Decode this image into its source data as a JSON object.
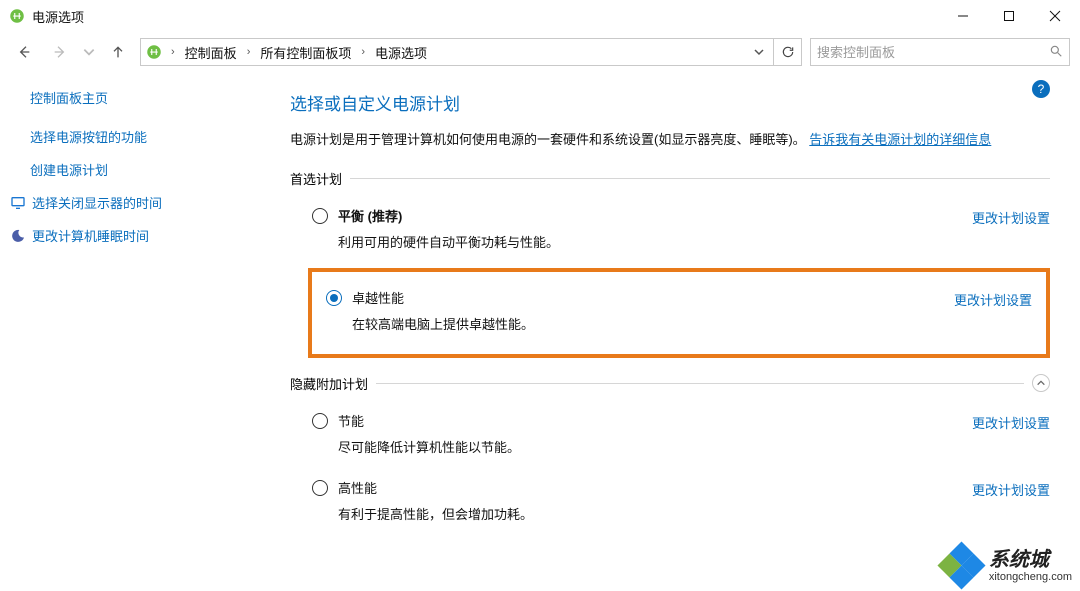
{
  "window": {
    "title": "电源选项"
  },
  "breadcrumb": {
    "seg1": "控制面板",
    "seg2": "所有控制面板项",
    "seg3": "电源选项"
  },
  "search": {
    "placeholder": "搜索控制面板"
  },
  "sidebar": {
    "home": "控制面板主页",
    "links": [
      "选择电源按钮的功能",
      "创建电源计划",
      "选择关闭显示器的时间",
      "更改计算机睡眠时间"
    ]
  },
  "content": {
    "heading": "选择或自定义电源计划",
    "desc_prefix": "电源计划是用于管理计算机如何使用电源的一套硬件和系统设置(如显示器亮度、睡眠等)。",
    "desc_link": "告诉我有关电源计划的详细信息",
    "preferred_label": "首选计划",
    "hidden_label": "隐藏附加计划",
    "change_label": "更改计划设置",
    "plans_preferred": [
      {
        "title": "平衡 (推荐)",
        "desc": "利用可用的硬件自动平衡功耗与性能。",
        "selected": false,
        "highlighted": false
      },
      {
        "title": "卓越性能",
        "desc": "在较高端电脑上提供卓越性能。",
        "selected": true,
        "highlighted": true
      }
    ],
    "plans_hidden": [
      {
        "title": "节能",
        "desc": "尽可能降低计算机性能以节能。",
        "selected": false
      },
      {
        "title": "高性能",
        "desc": "有利于提高性能，但会增加功耗。",
        "selected": false
      }
    ]
  },
  "watermark": {
    "brand": "系统城",
    "url": "xitongcheng.com"
  },
  "colors": {
    "accent": "#0a6ebd",
    "highlight_border": "#e87a1a"
  }
}
